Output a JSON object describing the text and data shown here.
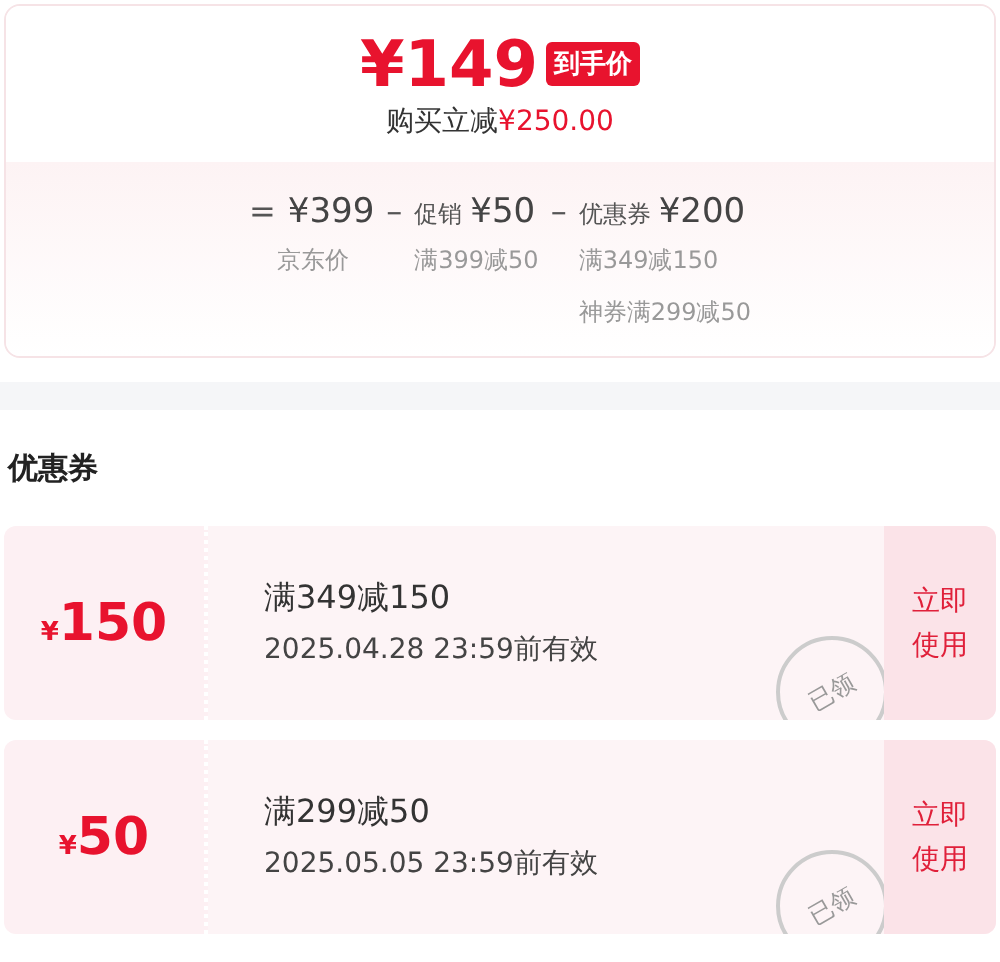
{
  "price": {
    "currency": "¥",
    "amount": "149",
    "badge": "到手价",
    "saving_label": "购买立减",
    "saving_amount": "¥250.00"
  },
  "breakdown": [
    {
      "operator": "=",
      "amount": "¥399",
      "notes": [
        "京东价"
      ]
    },
    {
      "operator": "–",
      "label": "促销",
      "amount": "¥50",
      "notes": [
        "满399减50"
      ]
    },
    {
      "operator": "–",
      "label": "优惠券",
      "amount": "¥200",
      "notes": [
        "满349减150",
        "神券满299减50"
      ]
    }
  ],
  "coupons_title": "优惠券",
  "coupons": [
    {
      "currency": "¥",
      "amount": "150",
      "condition": "满349减150",
      "expiry": "2025.04.28 23:59前有效",
      "stamp": "已领",
      "action": "立即使用"
    },
    {
      "currency": "¥",
      "amount": "50",
      "condition": "满299减50",
      "expiry": "2025.05.05 23:59前有效",
      "stamp": "已领",
      "action": "立即使用"
    }
  ]
}
